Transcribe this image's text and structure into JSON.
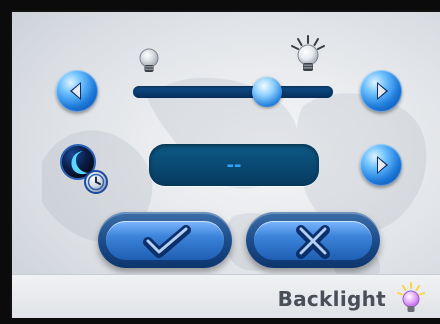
{
  "backlight": {
    "brightness_level_percent": 70,
    "timeout_value": "--",
    "title": "Backlight"
  },
  "icons": {
    "brightness_decrease": "left-arrow-icon",
    "brightness_increase": "right-arrow-icon",
    "timeout_next": "right-arrow-icon",
    "timeout": "moon-clock-icon",
    "ok": "checkmark-icon",
    "cancel": "x-icon",
    "dim": "bulb-dim-icon",
    "bright": "bulb-bright-icon",
    "logo": "lightbulb-logo-icon"
  },
  "colors": {
    "accent_blue": "#1B78D9",
    "track_dark": "#062E5B",
    "timeout_text": "#2CA4FF",
    "label_text": "#4A4F58",
    "logo_bulb": "#C16BF0",
    "logo_rays": "#FFD43B"
  }
}
